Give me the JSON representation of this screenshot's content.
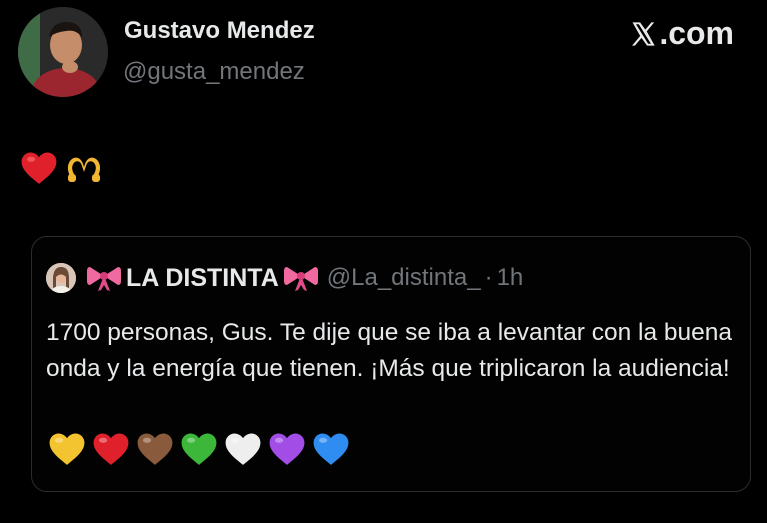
{
  "post": {
    "author_name": "Gustavo Mendez",
    "author_handle": "@gusta_mendez",
    "brand": ".com",
    "brand_icon": "x-logo-icon",
    "reactions": [
      "red-heart-emoji",
      "heart-hands-emoji"
    ]
  },
  "quote": {
    "name": "LA DISTINTA",
    "name_decor_icon": "ribbon-bow-emoji",
    "handle": "@La_distinta_",
    "separator": "·",
    "time": "1h",
    "text": "1700 personas, Gus. Te dije que se iba a levantar con la buena onda y la energía que tienen. ¡Más que triplicaron la audiencia!",
    "hearts": [
      {
        "name": "yellow-heart-icon",
        "color": "#f4c430"
      },
      {
        "name": "red-heart-icon",
        "color": "#e0202a"
      },
      {
        "name": "brown-heart-icon",
        "color": "#8a5a3c"
      },
      {
        "name": "green-heart-icon",
        "color": "#3cb73a"
      },
      {
        "name": "white-heart-icon",
        "color": "#eeeeee"
      },
      {
        "name": "purple-heart-icon",
        "color": "#a24ee6"
      },
      {
        "name": "blue-heart-icon",
        "color": "#2f8cf0"
      }
    ]
  },
  "colors": {
    "background": "#000000",
    "primary_text": "#e7e9ea",
    "secondary_text": "#71767b",
    "border": "#2a2d30"
  }
}
